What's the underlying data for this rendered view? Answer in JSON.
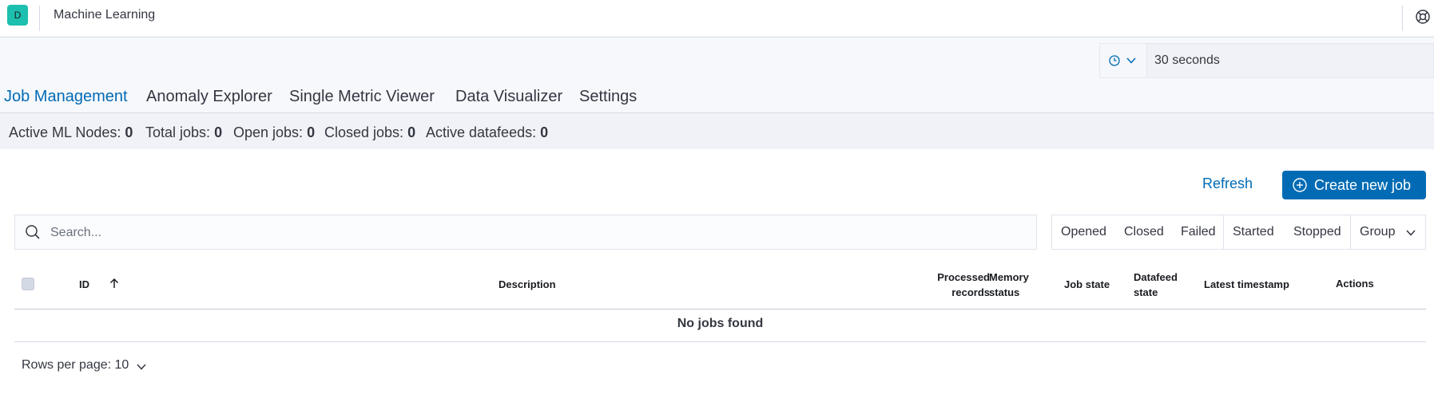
{
  "header": {
    "avatar_initial": "D",
    "app_title": "Machine Learning",
    "help_icon": "help-icon"
  },
  "refresh_interval": {
    "icon": "clock-icon",
    "value": "30 seconds"
  },
  "tabs": [
    {
      "label": "Job Management",
      "active": true
    },
    {
      "label": "Anomaly Explorer",
      "active": false
    },
    {
      "label": "Single Metric Viewer",
      "active": false
    },
    {
      "label": "Data Visualizer",
      "active": false
    },
    {
      "label": "Settings",
      "active": false
    }
  ],
  "stats": [
    {
      "label": "Active ML Nodes:",
      "value": "0"
    },
    {
      "label": "Total jobs:",
      "value": "0"
    },
    {
      "label": "Open jobs:",
      "value": "0"
    },
    {
      "label": "Closed jobs:",
      "value": "0"
    },
    {
      "label": "Active datafeeds:",
      "value": "0"
    }
  ],
  "actions": {
    "refresh_label": "Refresh",
    "create_label": "Create new job"
  },
  "search": {
    "placeholder": "Search..."
  },
  "filters": {
    "opened": "Opened",
    "closed": "Closed",
    "failed": "Failed",
    "started": "Started",
    "stopped": "Stopped",
    "group": "Group"
  },
  "table": {
    "columns": {
      "id": "ID",
      "description": "Description",
      "processed_records_1": "Processed",
      "processed_records_2": "records",
      "memory_status_1": "Memory",
      "memory_status_2": "status",
      "job_state": "Job state",
      "datafeed_state_1": "Datafeed",
      "datafeed_state_2": "state",
      "latest_timestamp": "Latest timestamp",
      "actions": "Actions"
    },
    "empty_message": "No jobs found"
  },
  "pagination": {
    "rows_per_page": "Rows per page: 10"
  },
  "colors": {
    "accent": "#006bb4",
    "avatar": "#1dbfae"
  }
}
